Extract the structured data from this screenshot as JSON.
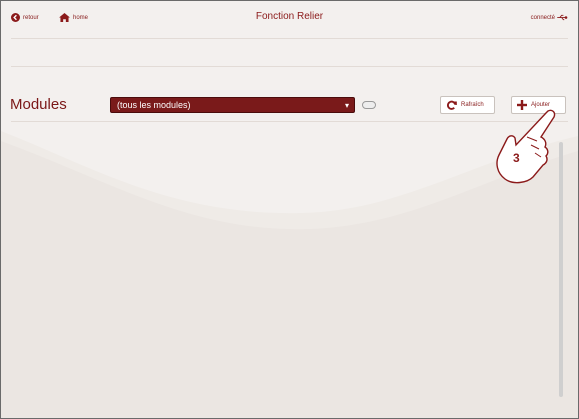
{
  "topbar": {
    "back_label": "retour",
    "home_label": "home",
    "title": "Fonction Relier",
    "status_label": "connecté"
  },
  "toolbar": {
    "modules_label": "Modules",
    "module_select_value": "(tous les modules)",
    "refresh_label": "Rafraîch",
    "add_label": "Ajouter"
  },
  "annotation": {
    "step_number": "3"
  },
  "colors": {
    "accent": "#7a1a1a",
    "background": "#f3f0ee"
  }
}
